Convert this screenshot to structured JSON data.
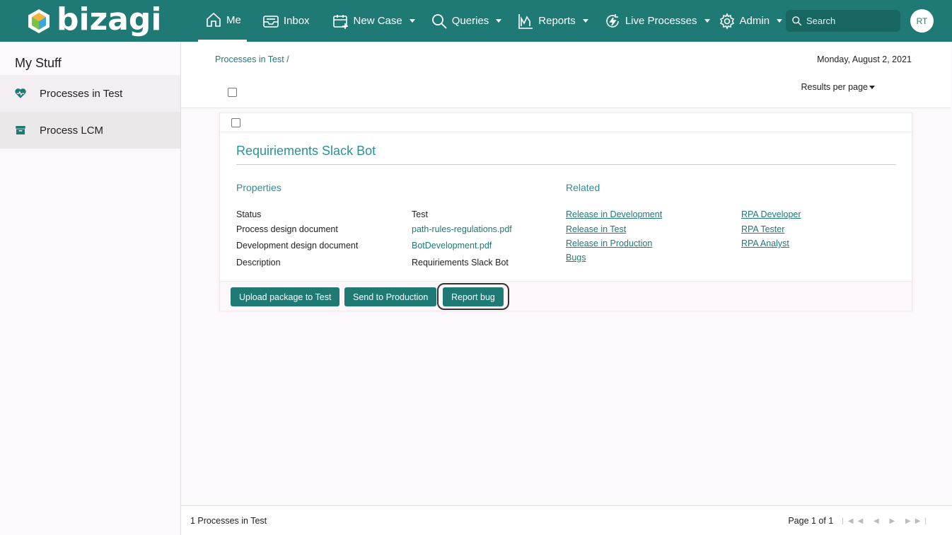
{
  "app": {
    "logo_text": "bizagi",
    "brand_color": "#1f7a76",
    "accent_color": "#2a9197"
  },
  "nav": {
    "items": [
      {
        "label": "Me",
        "icon": "home-icon",
        "active": true
      },
      {
        "label": "Inbox",
        "icon": "inbox-icon"
      },
      {
        "label": "New Case",
        "icon": "new-case-icon"
      },
      {
        "label": "Queries",
        "icon": "search-icon"
      },
      {
        "label": "Reports",
        "icon": "reports-icon"
      },
      {
        "label": "Live Processes",
        "icon": "live-processes-icon"
      },
      {
        "label": "Admin",
        "icon": "gear-icon"
      }
    ],
    "search_placeholder": "Search",
    "avatar_initials": "RT"
  },
  "sidebar": {
    "title": "My Stuff",
    "items": [
      {
        "label": "Processes in Test",
        "icon": "heart-pulse-icon"
      },
      {
        "label": "Process LCM",
        "icon": "archive-icon"
      }
    ]
  },
  "main": {
    "breadcrumb": "Processes in Test /",
    "date": "Monday, August 2, 2021",
    "results_per_page": "Results per page",
    "card": {
      "title": "Requiriements Slack Bot",
      "properties_title": "Properties",
      "related_title": "Related",
      "properties": [
        {
          "label": "Status",
          "value": "Test"
        },
        {
          "label": "Process design document",
          "value": "path-rules-regulations.pdf"
        },
        {
          "label": "Development design document",
          "value": "BotDevelopment.pdf"
        },
        {
          "label": "Description",
          "value": "Requiriements Slack Bot"
        }
      ],
      "related_col1": [
        "Release in Development",
        "Release in Test",
        "Release in Production",
        "Bugs"
      ],
      "related_col2": [
        "RPA Developer",
        "RPA Tester",
        "RPA Analyst"
      ],
      "buttons": {
        "upload": "Upload package to Test",
        "send": "Send to Production",
        "report": "Report bug"
      }
    },
    "footer": {
      "count": "1 Processes in Test",
      "page": "Page 1 of 1"
    }
  }
}
